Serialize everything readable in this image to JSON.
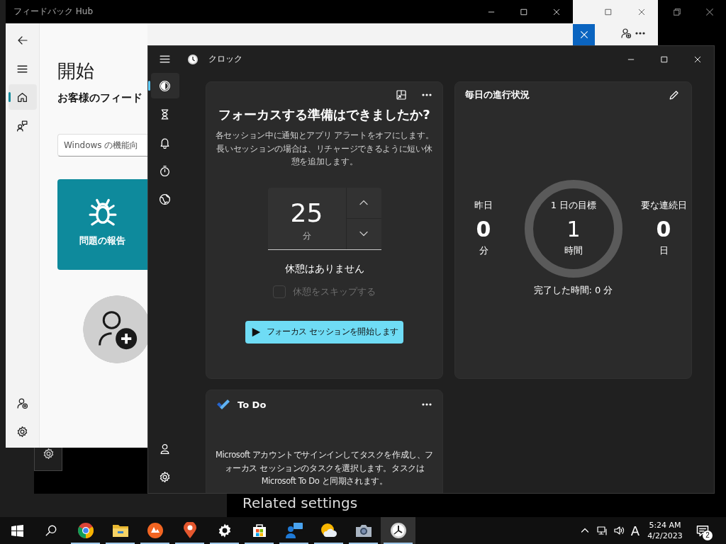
{
  "settings_window": {
    "heading": "Related settings"
  },
  "feedback_hub": {
    "title": "フィードバック Hub",
    "nav": [
      {
        "kind": "home",
        "selected": true
      },
      {
        "kind": "feedback",
        "selected": false
      }
    ],
    "heading": "開始",
    "subheading": "お客様のフィード",
    "search": {
      "placeholder": "Windows の機能向"
    },
    "tile": {
      "label": "問題の報告"
    }
  },
  "clock": {
    "title": "クロック",
    "nav": [
      {
        "kind": "focus",
        "selected": true
      },
      {
        "kind": "timer",
        "selected": false
      },
      {
        "kind": "alarm",
        "selected": false
      },
      {
        "kind": "stopwatch",
        "selected": false
      },
      {
        "kind": "world",
        "selected": false
      }
    ],
    "focus": {
      "title": "フォーカスする準備はできましたか?",
      "description": "各セッション中に通知とアプリ アラートをオフにします。長いセッションの場合は、リチャージできるように短い休憩を追加します。",
      "minutes": "25",
      "unit": "分",
      "breaks": "休憩はありません",
      "skip": {
        "label": "休憩をスキップする",
        "checked": false,
        "disabled": true
      },
      "start_button": "フォーカス セッションを開始します"
    },
    "progress": {
      "title": "毎日の進行状況",
      "stats": [
        {
          "label": "昨日",
          "value": "0",
          "unit": "分"
        },
        {
          "label": "1 日の目標",
          "value": "1",
          "unit": "時間"
        },
        {
          "label": "要な連続日",
          "value": "0",
          "unit": "日"
        }
      ],
      "completed": "完了した時間: 0 分"
    },
    "todo": {
      "title": "To Do",
      "message": "Microsoft アカウントでサインインしてタスクを作成し、フォーカス セッションのタスクを選択します。タスクは Microsoft To Do と同期されます。"
    }
  },
  "taskbar": {
    "apps": [
      {
        "kind": "chrome",
        "running": true,
        "selected": false
      },
      {
        "kind": "folder",
        "running": true,
        "selected": false
      },
      {
        "kind": "orange",
        "running": true,
        "selected": false
      },
      {
        "kind": "pin",
        "running": true,
        "selected": false
      },
      {
        "kind": "settings",
        "running": true,
        "selected": false
      },
      {
        "kind": "store",
        "running": true,
        "selected": false
      },
      {
        "kind": "feedback",
        "running": true,
        "selected": false
      },
      {
        "kind": "weather",
        "running": true,
        "selected": false
      },
      {
        "kind": "camera",
        "running": true,
        "selected": false
      },
      {
        "kind": "clock",
        "running": true,
        "selected": true
      }
    ],
    "input_indicator": "A",
    "time": "5:24 AM",
    "date": "4/2/2023",
    "notifications": "2"
  }
}
